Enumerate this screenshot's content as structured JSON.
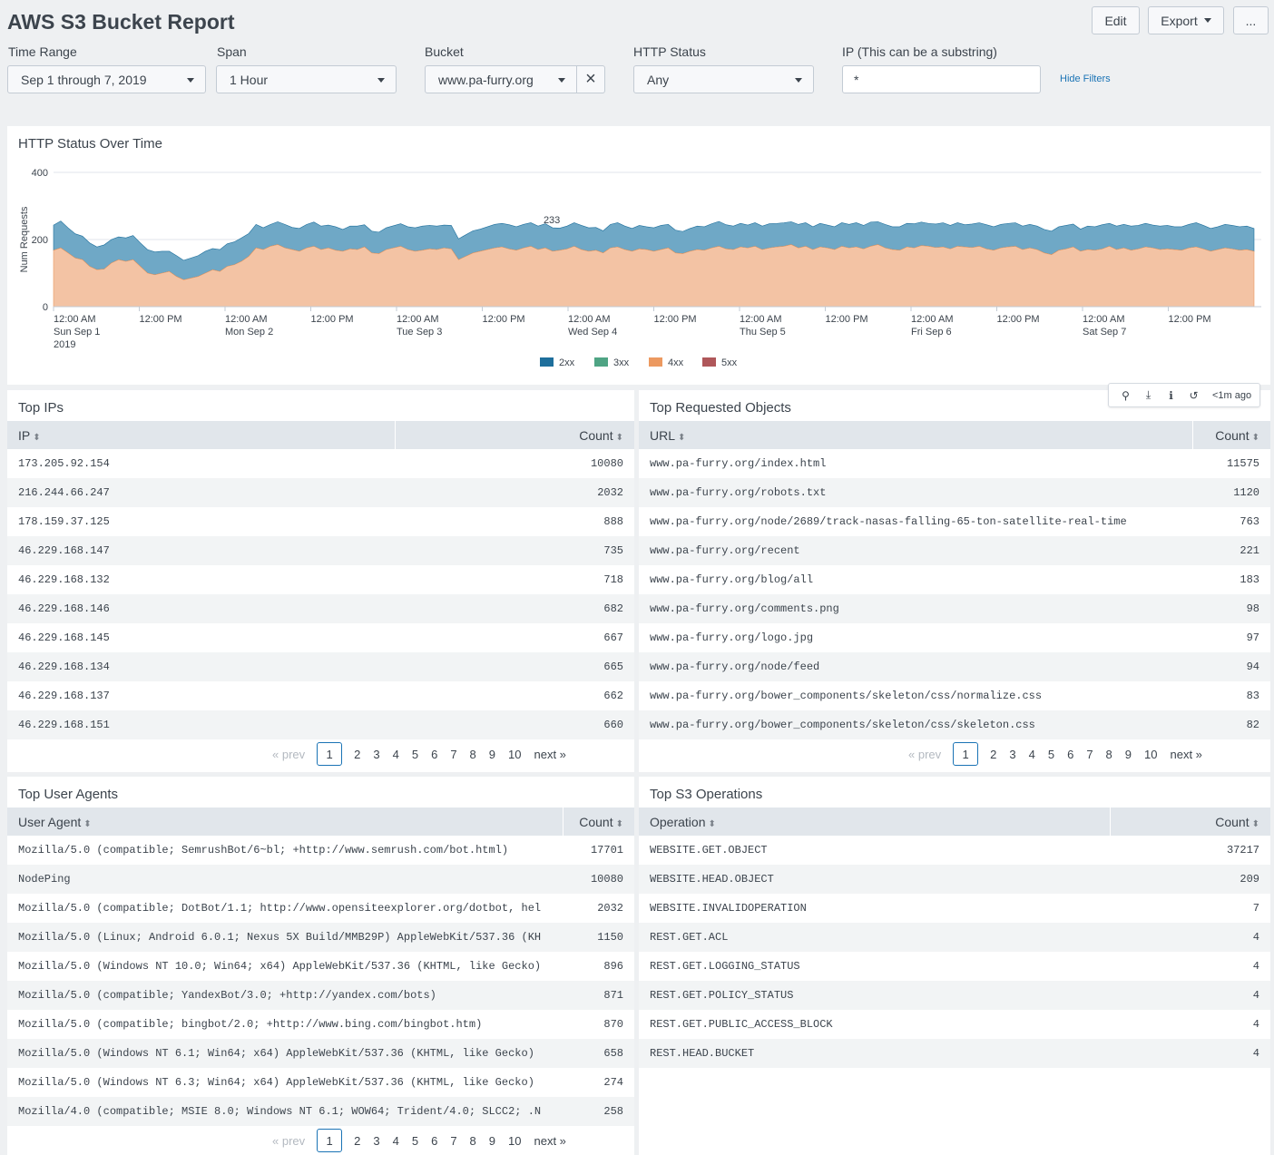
{
  "header": {
    "title": "AWS S3 Bucket Report",
    "edit_label": "Edit",
    "export_label": "Export",
    "more_label": "..."
  },
  "filters": {
    "time_range": {
      "label": "Time Range",
      "value": "Sep 1 through 7, 2019"
    },
    "span": {
      "label": "Span",
      "value": "1 Hour"
    },
    "bucket": {
      "label": "Bucket",
      "value": "www.pa-furry.org"
    },
    "http_status": {
      "label": "HTTP Status",
      "value": "Any"
    },
    "ip": {
      "label": "IP (This can be a substring)",
      "value": "*"
    },
    "hide_filters_label": "Hide Filters"
  },
  "chart_data": {
    "type": "area",
    "title": "HTTP Status Over Time",
    "ylabel": "Num Requests",
    "xlabel": "",
    "ylim": [
      0,
      400
    ],
    "yticks": [
      "400",
      "200",
      "0"
    ],
    "xticks": [
      [
        "12:00 AM",
        "Sun Sep 1",
        "2019"
      ],
      [
        "12:00 PM"
      ],
      [
        "12:00 AM",
        "Mon Sep 2"
      ],
      [
        "12:00 PM"
      ],
      [
        "12:00 AM",
        "Tue Sep 3"
      ],
      [
        "12:00 PM"
      ],
      [
        "12:00 AM",
        "Wed Sep 4"
      ],
      [
        "12:00 PM"
      ],
      [
        "12:00 AM",
        "Thu Sep 5"
      ],
      [
        "12:00 PM"
      ],
      [
        "12:00 AM",
        "Fri Sep 6"
      ],
      [
        "12:00 PM"
      ],
      [
        "12:00 AM",
        "Sat Sep 7"
      ],
      [
        "12:00 PM"
      ]
    ],
    "annotation": {
      "text": "233",
      "index": 68
    },
    "legend": [
      "2xx",
      "3xx",
      "4xx",
      "5xx"
    ],
    "legend_position": "bottom",
    "colors": {
      "2xx": "#1e6f9c",
      "3xx": "#4fa484",
      "4xx": "#ec9960",
      "5xx": "#af575a"
    },
    "series": [
      {
        "name": "2xx",
        "values": [
          75,
          80,
          75,
          72,
          70,
          70,
          68,
          72,
          70,
          68,
          70,
          72,
          70,
          70,
          68,
          65,
          60,
          62,
          58,
          60,
          62,
          65,
          63,
          65,
          67,
          68,
          70,
          68,
          70,
          65,
          65,
          68,
          70,
          66,
          68,
          70,
          72,
          70,
          68,
          70,
          65,
          68,
          70,
          66,
          65,
          64,
          65,
          66,
          67,
          68,
          70,
          72,
          70,
          70,
          68,
          70,
          62,
          64,
          66,
          66,
          68,
          70,
          70,
          72,
          70,
          70,
          70,
          70,
          72,
          70,
          66,
          68,
          70,
          72,
          70,
          68,
          66,
          70,
          72,
          70,
          68,
          70,
          68,
          70,
          72,
          70,
          68,
          66,
          68,
          70,
          70,
          72,
          74,
          72,
          70,
          70,
          68,
          70,
          70,
          72,
          70,
          70,
          68,
          70,
          70,
          68,
          70,
          68,
          68,
          70,
          70,
          72,
          70,
          72,
          68,
          70,
          68,
          70,
          70,
          72,
          70,
          68,
          70,
          72,
          70,
          70,
          66,
          70,
          70,
          72,
          70,
          70,
          70,
          70,
          70,
          70,
          70,
          70,
          70,
          70,
          70,
          68,
          66,
          70,
          70,
          72,
          68,
          70,
          70,
          72,
          70,
          70,
          68,
          70,
          70,
          68,
          70,
          70,
          72,
          70,
          68,
          68,
          70,
          70,
          70,
          70,
          68
        ]
      },
      {
        "name": "3xx",
        "values": [
          0,
          0,
          0,
          0,
          0,
          0,
          0,
          0,
          0,
          0,
          0,
          0,
          0,
          0,
          0,
          0,
          0,
          0,
          0,
          0,
          0,
          0,
          0,
          0,
          0,
          0,
          0,
          0,
          0,
          0,
          0,
          0,
          0,
          0,
          0,
          0,
          0,
          0,
          0,
          0,
          0,
          0,
          0,
          0,
          0,
          0,
          0,
          0,
          0,
          0,
          0,
          0,
          0,
          0,
          0,
          0,
          0,
          0,
          0,
          0,
          0,
          0,
          0,
          0,
          0,
          0,
          0,
          0,
          0,
          0,
          0,
          0,
          0,
          0,
          0,
          0,
          0,
          0,
          0,
          0,
          0,
          0,
          0,
          0,
          0,
          0,
          0,
          0,
          0,
          0,
          0,
          0,
          0,
          0,
          0,
          0,
          0,
          0,
          0,
          0,
          0,
          0,
          0,
          0,
          0,
          0,
          0,
          0,
          0,
          0,
          0,
          0,
          0,
          0,
          0,
          0,
          0,
          0,
          0,
          0,
          0,
          0,
          0,
          0,
          0,
          0,
          0,
          0,
          0,
          0,
          0,
          0,
          0,
          0,
          0,
          0,
          0,
          0,
          0,
          0,
          0,
          0,
          0,
          0,
          0,
          0,
          0,
          0,
          0,
          0,
          0,
          0,
          0,
          0,
          0,
          0,
          0,
          0,
          0,
          0,
          0,
          0,
          0,
          0,
          0,
          0,
          0
        ]
      },
      {
        "name": "4xx",
        "values": [
          168,
          175,
          160,
          145,
          140,
          120,
          110,
          112,
          130,
          140,
          135,
          140,
          120,
          100,
          95,
          100,
          105,
          90,
          80,
          85,
          90,
          100,
          110,
          105,
          120,
          125,
          135,
          150,
          175,
          170,
          180,
          185,
          175,
          170,
          165,
          175,
          180,
          170,
          175,
          168,
          165,
          172,
          170,
          178,
          160,
          158,
          170,
          175,
          180,
          170,
          165,
          168,
          172,
          170,
          175,
          172,
          140,
          150,
          160,
          165,
          170,
          175,
          178,
          172,
          168,
          175,
          180,
          170,
          175,
          165,
          168,
          172,
          180,
          170,
          165,
          168,
          160,
          175,
          178,
          170,
          165,
          172,
          170,
          165,
          170,
          175,
          160,
          158,
          165,
          170,
          168,
          175,
          180,
          172,
          170,
          178,
          175,
          180,
          170,
          175,
          178,
          180,
          185,
          175,
          180,
          170,
          178,
          175,
          170,
          180,
          175,
          178,
          172,
          180,
          185,
          175,
          170,
          168,
          178,
          175,
          182,
          180,
          176,
          178,
          172,
          180,
          178,
          176,
          180,
          172,
          168,
          175,
          178,
          180,
          170,
          175,
          170,
          160,
          155,
          168,
          172,
          178,
          165,
          170,
          168,
          172,
          180,
          170,
          175,
          168,
          172,
          178,
          175,
          170,
          172,
          170,
          168,
          175,
          178,
          172,
          165,
          170,
          175,
          172,
          168,
          170,
          165
        ]
      },
      {
        "name": "5xx",
        "values": [
          0,
          0,
          0,
          0,
          0,
          0,
          0,
          0,
          0,
          0,
          0,
          0,
          0,
          0,
          0,
          0,
          0,
          0,
          0,
          0,
          0,
          0,
          0,
          0,
          0,
          0,
          0,
          0,
          0,
          0,
          0,
          0,
          0,
          0,
          0,
          0,
          0,
          0,
          0,
          0,
          0,
          0,
          0,
          0,
          0,
          0,
          0,
          0,
          0,
          0,
          0,
          0,
          0,
          0,
          0,
          0,
          0,
          0,
          0,
          0,
          0,
          0,
          0,
          0,
          0,
          0,
          0,
          0,
          0,
          0,
          0,
          0,
          0,
          0,
          0,
          0,
          0,
          0,
          0,
          0,
          0,
          0,
          0,
          0,
          0,
          0,
          0,
          0,
          0,
          0,
          0,
          0,
          0,
          0,
          0,
          0,
          0,
          0,
          0,
          0,
          0,
          0,
          0,
          0,
          0,
          0,
          0,
          0,
          0,
          0,
          0,
          0,
          0,
          0,
          0,
          0,
          0,
          0,
          0,
          0,
          0,
          0,
          0,
          0,
          0,
          0,
          0,
          0,
          0,
          0,
          0,
          0,
          0,
          0,
          0,
          0,
          0,
          0,
          0,
          0,
          0,
          0,
          0,
          0,
          0,
          0,
          0,
          0,
          0,
          0,
          0,
          0,
          0,
          0,
          0,
          0,
          0,
          0,
          0,
          0,
          0,
          0,
          0,
          0,
          0,
          0,
          0
        ]
      }
    ]
  },
  "top_ips": {
    "title": "Top IPs",
    "columns": [
      "IP",
      "Count"
    ],
    "rows": [
      [
        "173.205.92.154",
        "10080"
      ],
      [
        "216.244.66.247",
        "2032"
      ],
      [
        "178.159.37.125",
        "888"
      ],
      [
        "46.229.168.147",
        "735"
      ],
      [
        "46.229.168.132",
        "718"
      ],
      [
        "46.229.168.146",
        "682"
      ],
      [
        "46.229.168.145",
        "667"
      ],
      [
        "46.229.168.134",
        "665"
      ],
      [
        "46.229.168.137",
        "662"
      ],
      [
        "46.229.168.151",
        "660"
      ]
    ]
  },
  "top_objects": {
    "title": "Top Requested Objects",
    "columns": [
      "URL",
      "Count"
    ],
    "rows": [
      [
        "www.pa-furry.org/index.html",
        "11575"
      ],
      [
        "www.pa-furry.org/robots.txt",
        "1120"
      ],
      [
        "www.pa-furry.org/node/2689/track-nasas-falling-65-ton-satellite-real-time",
        "763"
      ],
      [
        "www.pa-furry.org/recent",
        "221"
      ],
      [
        "www.pa-furry.org/blog/all",
        "183"
      ],
      [
        "www.pa-furry.org/comments.png",
        "98"
      ],
      [
        "www.pa-furry.org/logo.jpg",
        "97"
      ],
      [
        "www.pa-furry.org/node/feed",
        "94"
      ],
      [
        "www.pa-furry.org/bower_components/skeleton/css/normalize.css",
        "83"
      ],
      [
        "www.pa-furry.org/bower_components/skeleton/css/skeleton.css",
        "82"
      ]
    ],
    "toolbar_time": "<1m ago"
  },
  "top_user_agents": {
    "title": "Top User Agents",
    "columns": [
      "User Agent",
      "Count"
    ],
    "rows": [
      [
        "Mozilla/5.0 (compatible; SemrushBot/6~bl; +http://www.semrush.com/bot.html)",
        "17701"
      ],
      [
        "NodePing",
        "10080"
      ],
      [
        "Mozilla/5.0 (compatible; DotBot/1.1; http://www.opensiteexplorer.org/dotbot, hel",
        "2032"
      ],
      [
        "Mozilla/5.0 (Linux; Android 6.0.1; Nexus 5X Build/MMB29P) AppleWebKit/537.36 (KH",
        "1150"
      ],
      [
        "Mozilla/5.0 (Windows NT 10.0; Win64; x64) AppleWebKit/537.36 (KHTML, like Gecko)",
        "896"
      ],
      [
        "Mozilla/5.0 (compatible; YandexBot/3.0; +http://yandex.com/bots)",
        "871"
      ],
      [
        "Mozilla/5.0 (compatible; bingbot/2.0; +http://www.bing.com/bingbot.htm)",
        "870"
      ],
      [
        "Mozilla/5.0 (Windows NT 6.1; Win64; x64) AppleWebKit/537.36 (KHTML, like Gecko)",
        "658"
      ],
      [
        "Mozilla/5.0 (Windows NT 6.3; Win64; x64) AppleWebKit/537.36 (KHTML, like Gecko)",
        "274"
      ],
      [
        "Mozilla/4.0 (compatible; MSIE 8.0; Windows NT 6.1; WOW64; Trident/4.0; SLCC2; .N",
        "258"
      ]
    ]
  },
  "top_s3_ops": {
    "title": "Top S3 Operations",
    "columns": [
      "Operation",
      "Count"
    ],
    "rows": [
      [
        "WEBSITE.GET.OBJECT",
        "37217"
      ],
      [
        "WEBSITE.HEAD.OBJECT",
        "209"
      ],
      [
        "WEBSITE.INVALIDOPERATION",
        "7"
      ],
      [
        "REST.GET.ACL",
        "4"
      ],
      [
        "REST.GET.LOGGING_STATUS",
        "4"
      ],
      [
        "REST.GET.POLICY_STATUS",
        "4"
      ],
      [
        "REST.GET.PUBLIC_ACCESS_BLOCK",
        "4"
      ],
      [
        "REST.HEAD.BUCKET",
        "4"
      ]
    ]
  },
  "pagination": {
    "prev": "« prev",
    "next": "next »",
    "pages": [
      "1",
      "2",
      "3",
      "4",
      "5",
      "6",
      "7",
      "8",
      "9",
      "10"
    ],
    "current": "1"
  }
}
